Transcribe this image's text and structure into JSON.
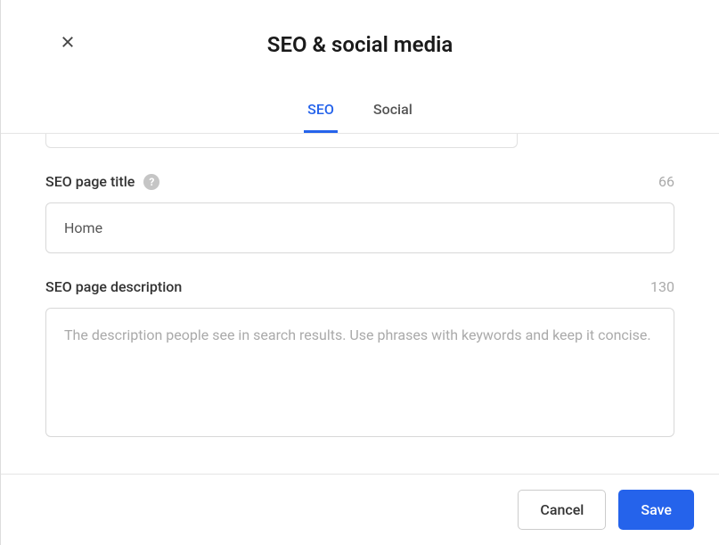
{
  "header": {
    "title": "SEO & social media"
  },
  "tabs": {
    "seo": "SEO",
    "social": "Social"
  },
  "fields": {
    "title": {
      "label": "SEO page title",
      "count": "66",
      "value": "Home"
    },
    "description": {
      "label": "SEO page description",
      "count": "130",
      "placeholder": "The description people see in search results. Use phrases with keywords and keep it concise.",
      "value": ""
    }
  },
  "footer": {
    "cancel": "Cancel",
    "save": "Save"
  }
}
